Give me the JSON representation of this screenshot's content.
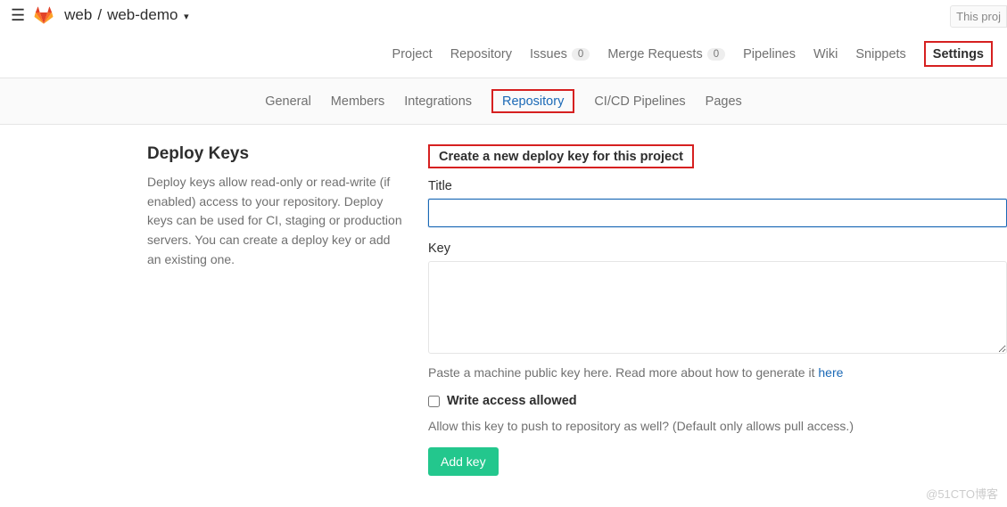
{
  "header": {
    "breadcrumb_group": "web",
    "breadcrumb_project": "web-demo",
    "top_right_btn": "This proj"
  },
  "nav1": {
    "project": "Project",
    "repository": "Repository",
    "issues": "Issues",
    "issues_count": "0",
    "merge_requests": "Merge Requests",
    "merge_requests_count": "0",
    "pipelines": "Pipelines",
    "wiki": "Wiki",
    "snippets": "Snippets",
    "settings": "Settings"
  },
  "nav2": {
    "general": "General",
    "members": "Members",
    "integrations": "Integrations",
    "repository": "Repository",
    "cicd": "CI/CD Pipelines",
    "pages": "Pages"
  },
  "left": {
    "heading": "Deploy Keys",
    "description": "Deploy keys allow read-only or read-write (if enabled) access to your repository. Deploy keys can be used for CI, staging or production servers. You can create a deploy key or add an existing one."
  },
  "form": {
    "section_title": "Create a new deploy key for this project",
    "title_label": "Title",
    "title_value": "",
    "key_label": "Key",
    "key_value": "",
    "key_help_prefix": "Paste a machine public key here. Read more about how to generate it ",
    "key_help_link": "here",
    "write_access_label": "Write access allowed",
    "write_access_help": "Allow this key to push to repository as well? (Default only allows pull access.)",
    "submit": "Add key"
  },
  "watermark": "@51CTO博客"
}
